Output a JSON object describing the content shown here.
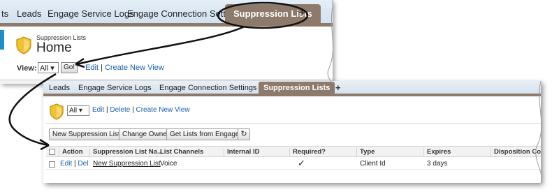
{
  "panel1": {
    "tabs": [
      {
        "label": "ts"
      },
      {
        "label": "Leads"
      },
      {
        "label": "Engage Service Logs"
      },
      {
        "label": "Engage Connection Settings"
      },
      {
        "label": "Suppression Lists"
      }
    ],
    "add_tab": "+",
    "breadcrumb": "Suppression Lists",
    "title": "Home",
    "view_label": "View:",
    "view_value": "All ▾",
    "go_label": "Go!",
    "edit_link": "Edit",
    "separator": "|",
    "create_view_link": "Create New View"
  },
  "panel2": {
    "tabs": [
      {
        "label": "Leads"
      },
      {
        "label": "Engage Service Logs"
      },
      {
        "label": "Engage Connection Settings"
      },
      {
        "label": "Suppression Lists"
      }
    ],
    "add_tab": "+",
    "view_value": "All ▾",
    "edit_link": "Edit",
    "delete_link": "Delete",
    "create_view_link": "Create New View",
    "separator": "|",
    "buttons": {
      "new": "New Suppression List",
      "change_owner": "Change Owner",
      "get_lists": "Get Lists from Engage",
      "refresh": "↻"
    },
    "columns": [
      "Action",
      "Suppression List Na...",
      "List Channels",
      "Internal ID",
      "Required?",
      "Type",
      "Expires",
      "Disposition Cod"
    ],
    "row": {
      "action_edit": "Edit",
      "action_del": "Del",
      "name": "New Suppression List",
      "channels": "Voice",
      "internal_id": "",
      "required": "✓",
      "type": "Client Id",
      "expires": "3 days",
      "disposition": ""
    }
  },
  "colors": {
    "tab_active": "#8d7a6a",
    "tab_bar": "#d6e3ef",
    "link": "#1b5fa8",
    "shield": "#f2c12e"
  }
}
